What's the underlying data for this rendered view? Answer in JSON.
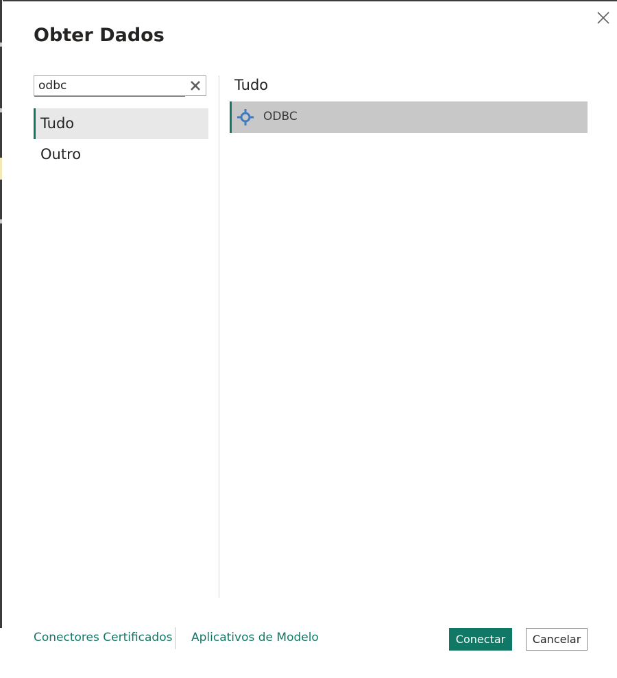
{
  "dialog": {
    "title": "Obter Dados",
    "close_icon": "close-icon"
  },
  "search": {
    "value": "odbc",
    "clear_icon": "clear-search-icon"
  },
  "categories": [
    {
      "label": "Tudo",
      "selected": true
    },
    {
      "label": "Outro",
      "selected": false
    }
  ],
  "results": {
    "section_title": "Tudo",
    "items": [
      {
        "label": "ODBC",
        "icon": "odbc-connector-icon",
        "selected": true
      }
    ]
  },
  "footer": {
    "link_certified": "Conectores Certificados",
    "link_template_apps": "Aplicativos de Modelo",
    "connect_label": "Conectar",
    "cancel_label": "Cancelar"
  },
  "colors": {
    "accent": "#117865",
    "selected_result_bg": "#c8c8c8",
    "selected_category_bg": "#e8e8e8",
    "text": "#252423",
    "icon_blue": "#3f7cbf"
  }
}
